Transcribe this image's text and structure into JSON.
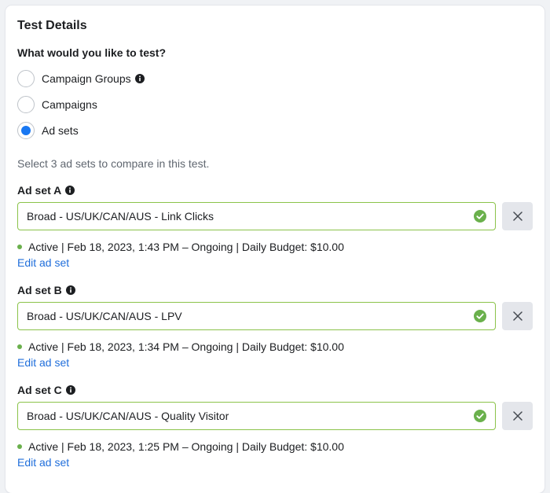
{
  "section_title": "Test Details",
  "question": "What would you like to test?",
  "options": [
    {
      "label": "Campaign Groups",
      "selected": false,
      "has_info": true
    },
    {
      "label": "Campaigns",
      "selected": false,
      "has_info": false
    },
    {
      "label": "Ad sets",
      "selected": true,
      "has_info": false
    }
  ],
  "helper_text": "Select 3 ad sets to compare in this test.",
  "adsets": [
    {
      "label": "Ad set A",
      "value": "Broad - US/UK/CAN/AUS - Link Clicks",
      "status": "Active | Feb 18, 2023, 1:43 PM – Ongoing | Daily Budget: $10.00",
      "edit_label": "Edit ad set"
    },
    {
      "label": "Ad set B",
      "value": "Broad - US/UK/CAN/AUS - LPV",
      "status": "Active | Feb 18, 2023, 1:34 PM – Ongoing | Daily Budget: $10.00",
      "edit_label": "Edit ad set"
    },
    {
      "label": "Ad set C",
      "value": "Broad - US/UK/CAN/AUS - Quality Visitor",
      "status": "Active | Feb 18, 2023, 1:25 PM – Ongoing | Daily Budget: $10.00",
      "edit_label": "Edit ad set"
    }
  ],
  "colors": {
    "accent": "#1877f2",
    "link": "#216fdb",
    "valid_border": "#8bc34a",
    "check": "#6ab04c",
    "status_dot": "#6ab04c"
  },
  "icons": {
    "info": "info-icon",
    "check": "check-circle-icon",
    "remove": "close-icon"
  }
}
